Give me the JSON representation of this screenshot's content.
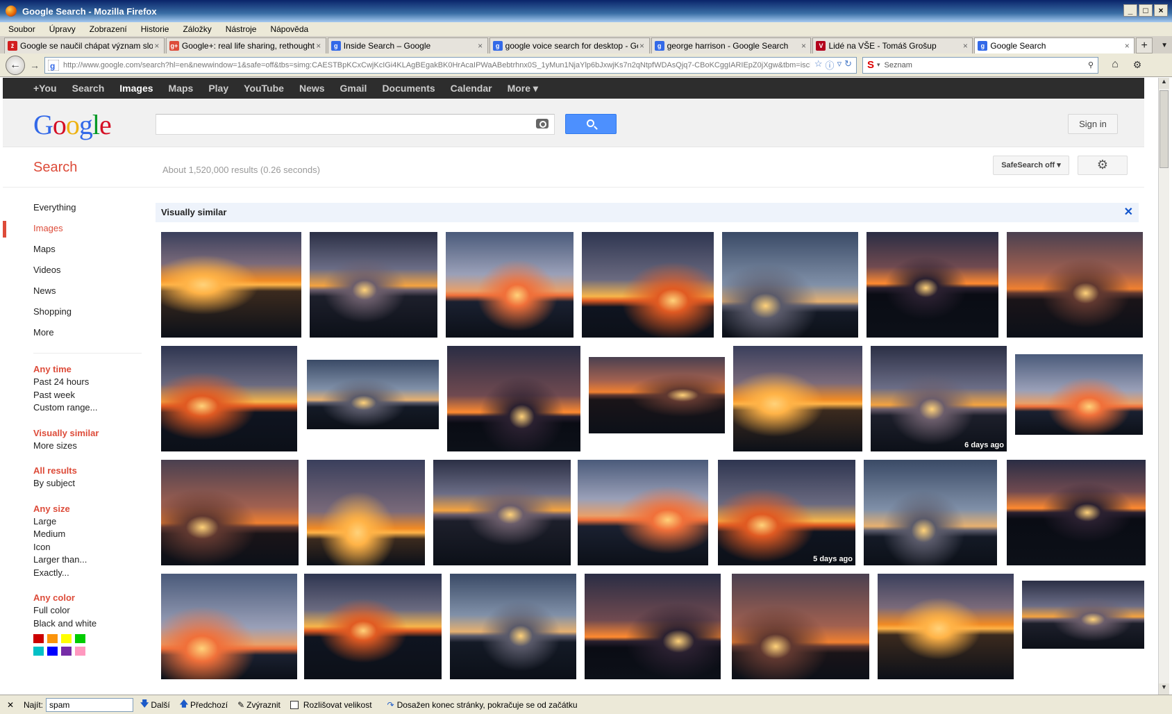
{
  "window": {
    "title": "Google Search - Mozilla Firefox",
    "buttons": [
      "_",
      "□",
      "×"
    ]
  },
  "menubar": [
    "Soubor",
    "Úpravy",
    "Zobrazení",
    "Historie",
    "Záložky",
    "Nástroje",
    "Nápověda"
  ],
  "tabs": [
    {
      "title": "Google se naučil chápat význam slov ...",
      "fav": "zive",
      "color": "#d21e1e"
    },
    {
      "title": "Google+: real life sharing, rethought ...",
      "fav": "g+",
      "color": "#dd4b39"
    },
    {
      "title": "Inside Search – Google",
      "fav": "g",
      "color": "#3369e8"
    },
    {
      "title": "google voice search for desktop - Go...",
      "fav": "g",
      "color": "#3369e8"
    },
    {
      "title": "george harrison - Google Search",
      "fav": "g",
      "color": "#3369e8"
    },
    {
      "title": "Lidé na VŠE - Tomáš Grošup",
      "fav": "vse",
      "color": "#b3001b"
    },
    {
      "title": "Google Search",
      "fav": "g",
      "color": "#3369e8",
      "active": true
    }
  ],
  "nav": {
    "url": "http://www.google.com/search?hl=en&newwindow=1&safe=off&tbs=simg:CAESTBpKCxCwjKcIGi4KLAgBEgakBK0HrAcaIPWaABebtrhnx0S_1yMun1NjaYlp6bJxwjKs7n2qNtpfWDAsQjq7-CBoKCggIARIEpZ0jXgw&tbm=isch&sa",
    "search_engine": "Seznam"
  },
  "gbar": {
    "items": [
      "+You",
      "Search",
      "Images",
      "Maps",
      "Play",
      "YouTube",
      "News",
      "Gmail",
      "Documents",
      "Calendar",
      "More ▾"
    ],
    "selected": "Images"
  },
  "header": {
    "sign_in": "Sign in",
    "search_value": ""
  },
  "subhead": {
    "label": "Search",
    "stats": "About 1,520,000 results (0.26 seconds)",
    "safesearch": "SafeSearch off ▾"
  },
  "leftnav": {
    "items": [
      "Everything",
      "Images",
      "Maps",
      "Videos",
      "News",
      "Shopping",
      "More"
    ],
    "selected": "Images",
    "groups": [
      {
        "heading": "Any time",
        "items": [
          "Past 24 hours",
          "Past week",
          "Custom range..."
        ]
      },
      {
        "heading": "Visually similar",
        "items": [
          "More sizes"
        ]
      },
      {
        "heading": "All results",
        "items": [
          "By subject"
        ]
      },
      {
        "heading": "Any size",
        "items": [
          "Large",
          "Medium",
          "Icon",
          "Larger than...",
          "Exactly..."
        ]
      },
      {
        "heading": "Any color",
        "items": [
          "Full color",
          "Black and white"
        ]
      }
    ],
    "colors": [
      "#cc0000",
      "#fb940b",
      "#ffff00",
      "#00cc00",
      "#03c0c6",
      "#0000ff",
      "#762ca7",
      "#ff98bf"
    ]
  },
  "results": {
    "header": "Visually similar",
    "badges": {
      "r2i6": "6 days ago",
      "r3i5": "5 days ago"
    }
  },
  "findbar": {
    "label": "Najít:",
    "value": "spam",
    "next": "Další",
    "prev": "Předchozí",
    "highlight": "Zvýraznit",
    "match_case": "Rozlišovat velikost",
    "status": "Dosažen konec stránky, pokračuje se od začátku"
  }
}
